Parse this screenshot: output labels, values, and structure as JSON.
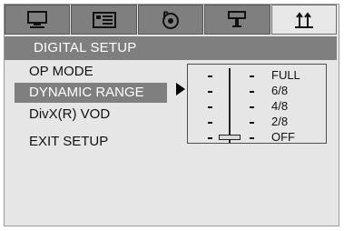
{
  "header": {
    "title": "DIGITAL SETUP"
  },
  "tabs": [
    {
      "icon": "monitor-icon",
      "active": false
    },
    {
      "icon": "settings-card-icon",
      "active": false
    },
    {
      "icon": "audio-disc-icon",
      "active": false
    },
    {
      "icon": "speaker-icon",
      "active": false
    },
    {
      "icon": "digital-setup-icon",
      "active": true
    }
  ],
  "menu": {
    "items": [
      {
        "label": "OP MODE",
        "selected": false
      },
      {
        "label": "DYNAMIC RANGE",
        "selected": true
      },
      {
        "label": "DivX(R) VOD",
        "selected": false
      },
      {
        "label": "EXIT SETUP",
        "selected": false
      }
    ]
  },
  "dynamic_range": {
    "options": [
      "FULL",
      "6/8",
      "4/8",
      "2/8",
      "OFF"
    ],
    "selected": "OFF"
  },
  "colors": {
    "background": "#e6e6e6",
    "highlight": "#7f7f7f",
    "text": "#111111",
    "header_text": "#ffffff"
  }
}
